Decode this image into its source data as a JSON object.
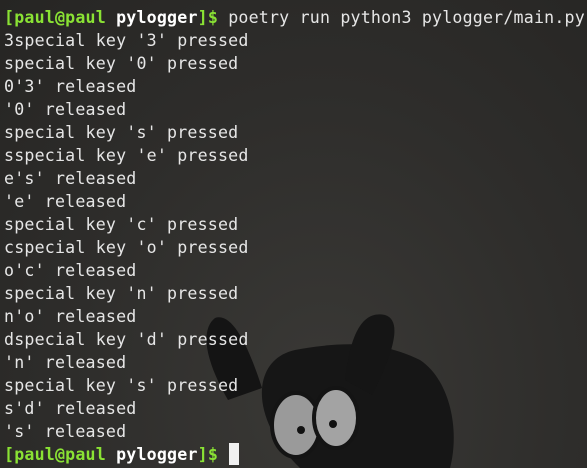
{
  "terminal": {
    "prompt": {
      "user_host": "[paul@paul",
      "directory": "pylogger",
      "symbol": "]$"
    },
    "command": "poetry run python3 pylogger/main.py",
    "output": [
      "3special key '3' pressed",
      "special key '0' pressed",
      "0'3' released",
      "'0' released",
      "special key 's' pressed",
      "sspecial key 'e' pressed",
      "e's' released",
      "'e' released",
      "special key 'c' pressed",
      "cspecial key 'o' pressed",
      "o'c' released",
      "special key 'n' pressed",
      "n'o' released",
      "dspecial key 'd' pressed",
      "'n' released",
      "special key 's' pressed",
      "s'd' released",
      "'s' released"
    ],
    "colors": {
      "background": "#2f2e2c",
      "text": "#e6e6e6",
      "prompt_accent": "#8ae234"
    }
  }
}
